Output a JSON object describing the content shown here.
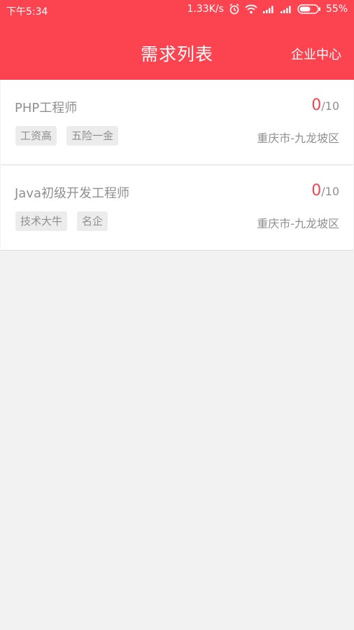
{
  "status_bar": {
    "time": "下午5:34",
    "net_speed": "1.33K/s",
    "battery": "55%",
    "icons": [
      "alarm-icon",
      "wifi-icon",
      "signal-icon",
      "signal-icon",
      "battery-icon"
    ]
  },
  "header": {
    "title": "需求列表",
    "corp_center": "企业中心",
    "bg_color": "#fc4451"
  },
  "jobs": [
    {
      "title": "PHP工程师",
      "current": "0",
      "total": "/10",
      "tags": [
        "工资高",
        "五险一金"
      ],
      "location": "重庆市-九龙坡区"
    },
    {
      "title": "Java初级开发工程师",
      "current": "0",
      "total": "/10",
      "tags": [
        "技术大牛",
        "名企"
      ],
      "location": "重庆市-九龙坡区"
    }
  ]
}
